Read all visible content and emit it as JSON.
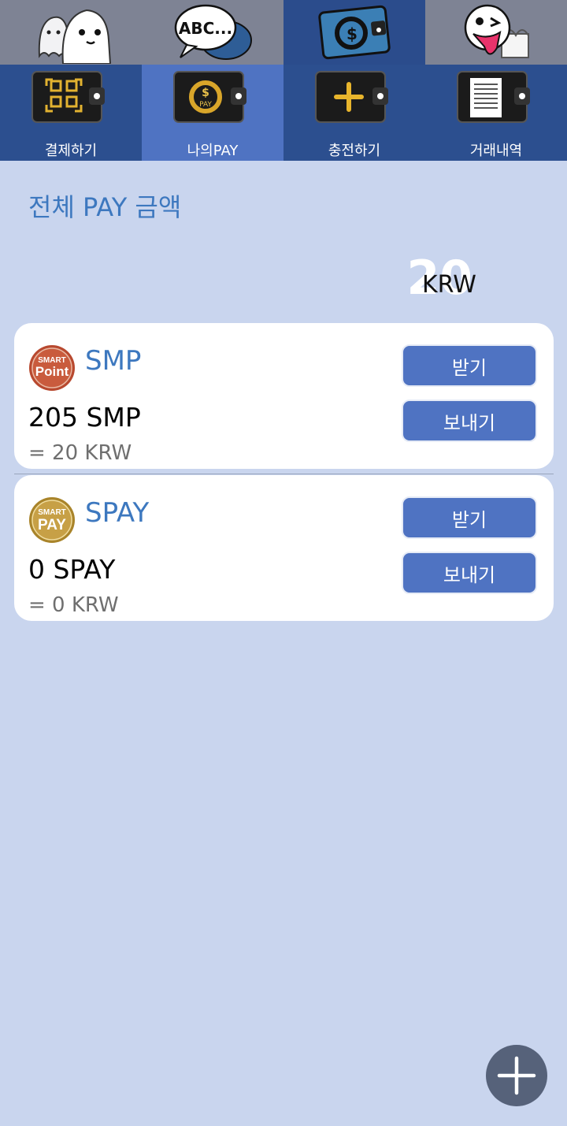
{
  "top_tabs": [
    {
      "icon": "ghost-icon"
    },
    {
      "icon": "speech-bubble-icon",
      "text": "ABC..."
    },
    {
      "icon": "wallet-coin-icon"
    },
    {
      "icon": "jack-in-box-icon"
    }
  ],
  "sub_tabs": [
    {
      "label": "결제하기",
      "icon": "qr-wallet-icon"
    },
    {
      "label": "나의PAY",
      "icon": "pay-wallet-icon",
      "active": true
    },
    {
      "label": "충전하기",
      "icon": "plus-wallet-icon"
    },
    {
      "label": "거래내역",
      "icon": "document-wallet-icon"
    }
  ],
  "total": {
    "title": "전체 PAY 금액",
    "amount": "20",
    "unit": "KRW"
  },
  "cards": [
    {
      "name": "SMP",
      "coin_text_top": "SMART",
      "coin_text_main": "Point",
      "balance": "205 SMP",
      "krw": "= 20 KRW",
      "receive_label": "받기",
      "send_label": "보내기"
    },
    {
      "name": "SPAY",
      "coin_text_top": "SMART",
      "coin_text_main": "PAY",
      "balance": "0 SPAY",
      "krw": "= 0 KRW",
      "receive_label": "받기",
      "send_label": "보내기"
    }
  ],
  "colors": {
    "background": "#c9d5ee",
    "accent": "#3d78bf",
    "button": "#4f73c2",
    "nav": "#2c4f8f",
    "nav_active": "#4f73c2"
  },
  "fab": {
    "icon": "plus-icon"
  }
}
